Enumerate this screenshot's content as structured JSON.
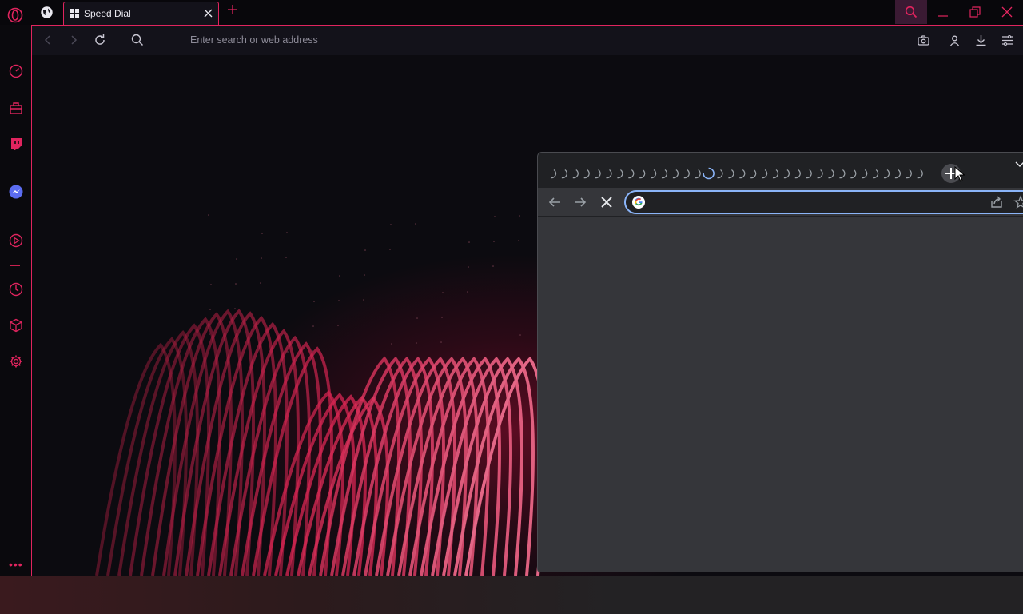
{
  "opera": {
    "tab": {
      "title": "Speed Dial"
    },
    "address_bar": {
      "placeholder": "Enter search or web address"
    },
    "accent_color": "#e0245e",
    "sidebar_icons": [
      "speed-dial-icon",
      "shopping-icon",
      "twitch-icon",
      "messenger-icon",
      "player-icon",
      "history-icon",
      "extensions-icon",
      "settings-icon"
    ]
  },
  "chrome": {
    "loading_tabs": 34,
    "omnibox_value": "",
    "accent_color": "#8ab4f8"
  }
}
